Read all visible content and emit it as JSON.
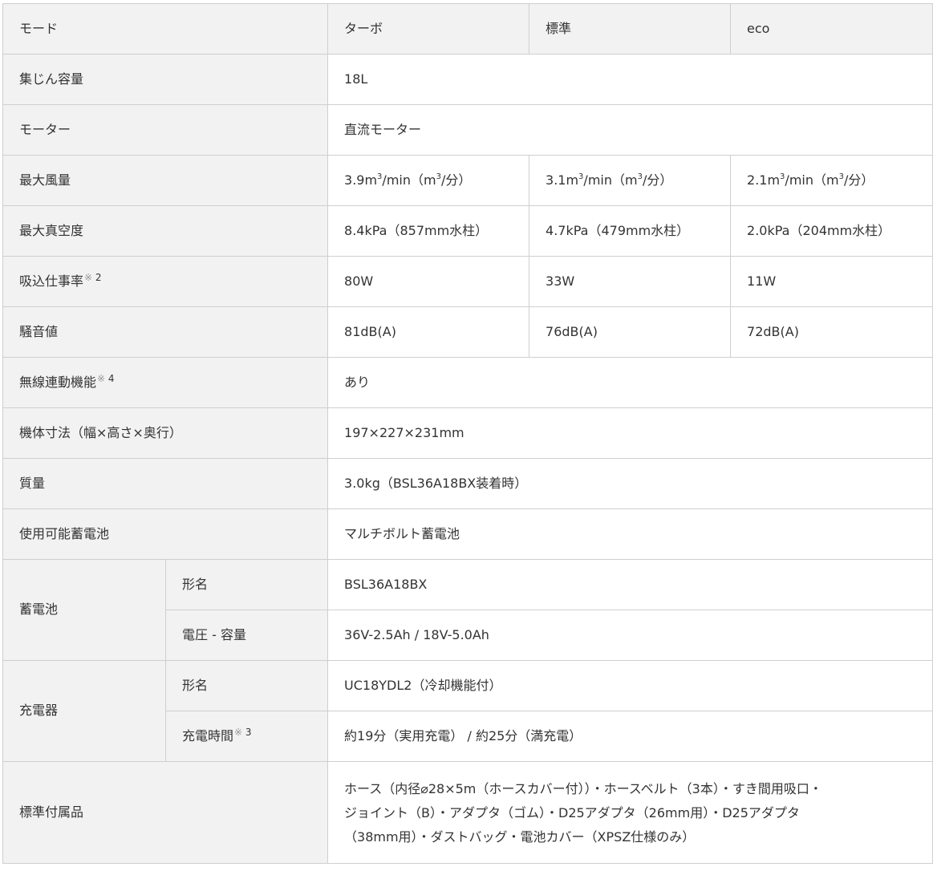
{
  "mode": {
    "label": "モード",
    "turbo": "ターボ",
    "standard": "標準",
    "eco": "eco"
  },
  "capacity": {
    "label": "集じん容量",
    "value": "18L"
  },
  "motor": {
    "label": "モーター",
    "value": "直流モーター"
  },
  "airflow": {
    "label": "最大風量",
    "turbo": {
      "num": "3.9m",
      "exp": "3",
      "mid": "/min（m",
      "exp2": "3",
      "tail": "/分）"
    },
    "standard": {
      "num": "3.1m",
      "exp": "3",
      "mid": "/min（m",
      "exp2": "3",
      "tail": "/分）"
    },
    "eco": {
      "num": "2.1m",
      "exp": "3",
      "mid": "/min（m",
      "exp2": "3",
      "tail": "/分）"
    }
  },
  "vacuum": {
    "label": "最大真空度",
    "turbo": "8.4kPa（857mm水柱）",
    "standard": "4.7kPa（479mm水柱）",
    "eco": "2.0kPa（204mm水柱）"
  },
  "suction": {
    "label": "吸込仕事率",
    "note_mark": "※",
    "note_num": "2",
    "turbo": "80W",
    "standard": "33W",
    "eco": "11W"
  },
  "noise": {
    "label": "騒音値",
    "turbo": "81dB(A)",
    "standard": "76dB(A)",
    "eco": "72dB(A)"
  },
  "wireless": {
    "label": "無線連動機能",
    "note_mark": "※",
    "note_num": "4",
    "value": "あり"
  },
  "dimensions": {
    "label": "機体寸法（幅×高さ×奥行）",
    "value": "197×227×231mm"
  },
  "weight": {
    "label": "質量",
    "value": "3.0kg（BSL36A18BX装着時）"
  },
  "usable_battery": {
    "label": "使用可能蓄電池",
    "value": "マルチボルト蓄電池"
  },
  "battery": {
    "label": "蓄電池",
    "model_label": "形名",
    "model_value": "BSL36A18BX",
    "voltage_label": "電圧 - 容量",
    "voltage_value": "36V-2.5Ah / 18V-5.0Ah"
  },
  "charger": {
    "label": "充電器",
    "model_label": "形名",
    "model_value": "UC18YDL2（冷却機能付）",
    "time_label": "充電時間",
    "time_note_mark": "※",
    "time_note_num": "3",
    "time_value": "約19分（実用充電） / 約25分（満充電）"
  },
  "accessories": {
    "label": "標準付属品",
    "line1": "ホース（内径⌀28×5m（ホースカバー付））・ホースベルト（3本）・すき間用吸口・",
    "line2": "ジョイント（B）・アダプタ（ゴム）・D25アダプタ（26mm用）・D25アダプタ",
    "line3": "（38mm用）・ダストバッグ・電池カバー（XPSZ仕様のみ）"
  }
}
